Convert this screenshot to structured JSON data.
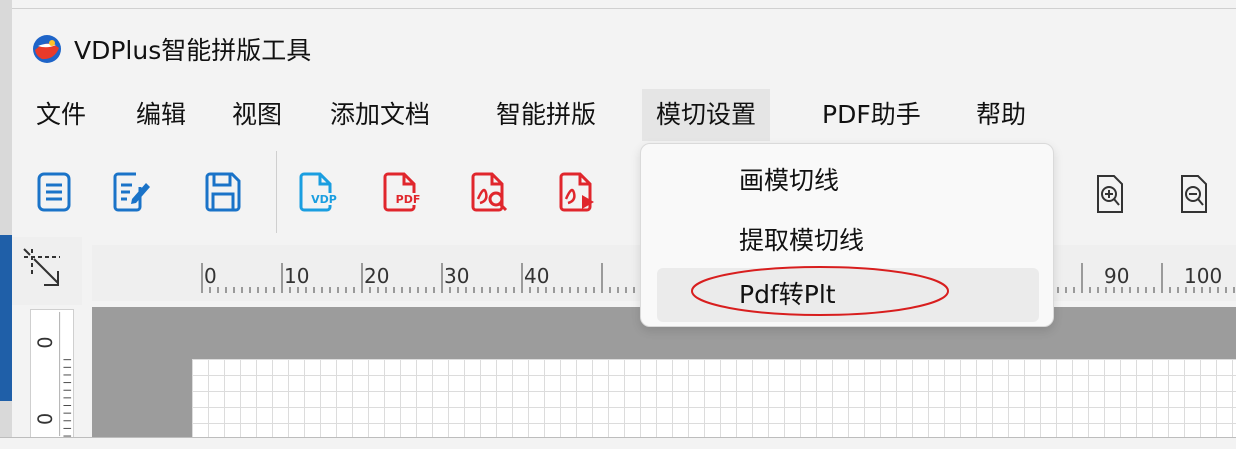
{
  "window": {
    "title": "VDPlus智能拼版工具"
  },
  "menubar": {
    "items": [
      {
        "label": "文件"
      },
      {
        "label": "编辑"
      },
      {
        "label": "视图"
      },
      {
        "label": "添加文档"
      },
      {
        "label": "智能拼版"
      },
      {
        "label": "模切设置"
      },
      {
        "label": "PDF助手"
      },
      {
        "label": "帮助"
      }
    ],
    "active_index": 5
  },
  "toolbar": {
    "buttons": [
      {
        "icon": "new-document-icon",
        "color": "#1a73c8"
      },
      {
        "icon": "edit-document-icon",
        "color": "#1a73c8"
      },
      {
        "icon": "save-icon",
        "color": "#1a73c8"
      },
      {
        "icon": "add-vdp-icon",
        "color": "#1a9ee0",
        "text": "VDP"
      },
      {
        "icon": "add-pdf-icon",
        "color": "#e0262c",
        "text": "PDF"
      },
      {
        "icon": "pdf-search-icon",
        "color": "#e0262c"
      },
      {
        "icon": "pdf-export-icon",
        "color": "#e0262c"
      }
    ],
    "zoom_in_icon": "zoom-in-icon",
    "zoom_out_icon": "zoom-out-icon"
  },
  "dropdown": {
    "items": [
      {
        "label": "画模切线"
      },
      {
        "label": "提取模切线"
      },
      {
        "label": "Pdf转Plt"
      }
    ],
    "highlighted_index": 2,
    "annotation_color": "#d81e1e"
  },
  "ruler": {
    "h_labels": [
      "0",
      "10",
      "20",
      "30",
      "40",
      "90",
      "100"
    ],
    "v_labels": [
      "0",
      "0"
    ]
  }
}
